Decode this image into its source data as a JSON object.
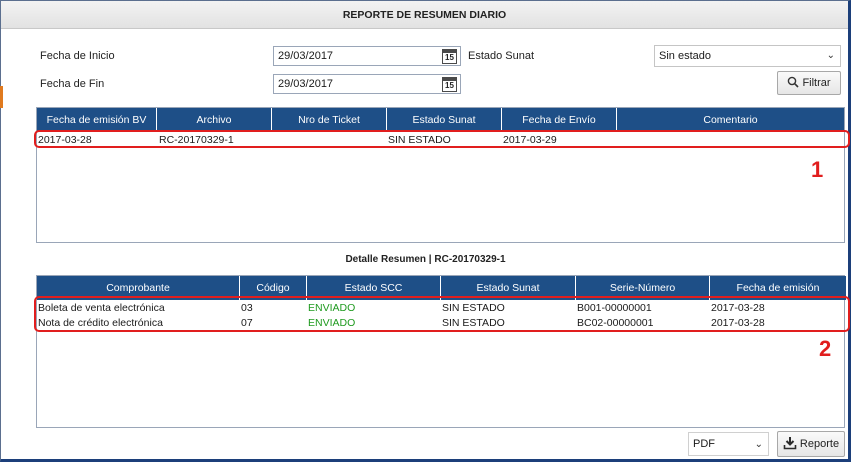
{
  "window": {
    "title": "REPORTE DE RESUMEN DIARIO"
  },
  "filters": {
    "fecha_inicio_label": "Fecha de Inicio",
    "fecha_inicio_value": "29/03/2017",
    "fecha_fin_label": "Fecha de Fin",
    "fecha_fin_value": "29/03/2017",
    "estado_sunat_label": "Estado Sunat",
    "estado_sunat_value": "Sin estado",
    "filtrar_label": "Filtrar",
    "calendar_day": "15"
  },
  "resumen_grid": {
    "columns": [
      "Fecha de emisión BV",
      "Archivo",
      "Nro de Ticket",
      "Estado Sunat",
      "Fecha de Envío",
      "Comentario"
    ],
    "rows": [
      [
        "2017-03-28",
        "RC-20170329-1",
        "",
        "SIN ESTADO",
        "2017-03-29",
        ""
      ]
    ]
  },
  "detalle": {
    "title": "Detalle Resumen | RC-20170329-1",
    "columns": [
      "Comprobante",
      "Código",
      "Estado SCC",
      "Estado Sunat",
      "Serie-Número",
      "Fecha de emisión"
    ],
    "rows": [
      [
        "Boleta de venta electrónica",
        "03",
        "ENVIADO",
        "SIN ESTADO",
        "B001-00000001",
        "2017-03-28"
      ],
      [
        "Nota de crédito electrónica",
        "07",
        "ENVIADO",
        "SIN ESTADO",
        "BC02-00000001",
        "2017-03-28"
      ]
    ]
  },
  "annotations": {
    "marker_1": "1",
    "marker_2": "2"
  },
  "footer": {
    "format_value": "PDF",
    "reporte_label": "Reporte"
  },
  "colors": {
    "header_blue": "#1e4f87",
    "status_green": "#1f9a1f",
    "highlight_red": "#e11e1e"
  }
}
